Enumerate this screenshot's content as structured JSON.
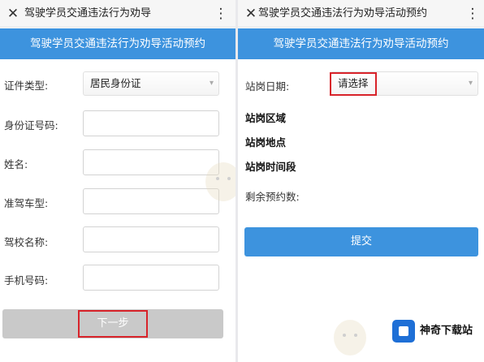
{
  "left": {
    "title": "驾驶学员交通违法行为劝导",
    "close_icon": "✕",
    "more_icon": "⋮",
    "banner": "驾驶学员交通违法行为劝导活动预约",
    "form": {
      "id_type_label": "证件类型:",
      "id_type_value": "居民身份证",
      "id_number_label": "身份证号码:",
      "name_label": "姓名:",
      "license_type_label": "准驾车型:",
      "school_label": "驾校名称:",
      "phone_label": "手机号码:"
    },
    "next_button": "下一步"
  },
  "right": {
    "title": "驾驶学员交通违法行为劝导活动预约",
    "close_icon": "✕",
    "more_icon": "⋮",
    "banner": "驾驶学员交通违法行为劝导活动预约",
    "date_label": "站岗日期:",
    "date_value": "请选择",
    "area_label": "站岗区域",
    "place_label": "站岗地点",
    "time_label": "站岗时间段",
    "remaining_label": "剩余预约数:",
    "submit_button": "提交"
  },
  "watermark": {
    "site_name": "神奇下载站",
    "brand_color": "#1e6fd6"
  },
  "colors": {
    "banner": "#3d93de",
    "highlight": "#d8232a",
    "disabled_button": "#c9c9c9"
  }
}
